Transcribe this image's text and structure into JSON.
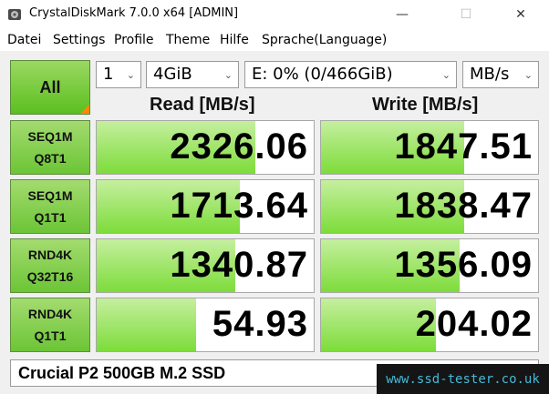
{
  "window": {
    "title": "CrystalDiskMark 7.0.0 x64 [ADMIN]",
    "minimize_label": "—",
    "maximize_label": "☐",
    "close_label": "✕"
  },
  "menu": {
    "items": [
      "Datei",
      "Settings",
      "Profile",
      "Theme",
      "Hilfe",
      "Sprache(Language)"
    ]
  },
  "controls": {
    "all_label": "All",
    "count": "1",
    "size": "4GiB",
    "drive": "E: 0% (0/466GiB)",
    "unit": "MB/s"
  },
  "headers": {
    "read": "Read [MB/s]",
    "write": "Write [MB/s]"
  },
  "rows": [
    {
      "line1": "SEQ1M",
      "line2": "Q8T1",
      "read": "2326.06",
      "write": "1847.51",
      "read_fill": 0.73,
      "write_fill": 0.66
    },
    {
      "line1": "SEQ1M",
      "line2": "Q1T1",
      "read": "1713.64",
      "write": "1838.47",
      "read_fill": 0.66,
      "write_fill": 0.66
    },
    {
      "line1": "RND4K",
      "line2": "Q32T16",
      "read": "1340.87",
      "write": "1356.09",
      "read_fill": 0.64,
      "write_fill": 0.64
    },
    {
      "line1": "RND4K",
      "line2": "Q1T1",
      "read": "54.93",
      "write": "204.02",
      "read_fill": 0.46,
      "write_fill": 0.53
    }
  ],
  "comment": "Crucial P2 500GB M.2 SSD",
  "watermark": "www.ssd-tester.co.uk",
  "colors": {
    "accent_green": "#7ddc3a",
    "corner_orange": "#ff8a00",
    "watermark_text": "#46b8d6"
  }
}
